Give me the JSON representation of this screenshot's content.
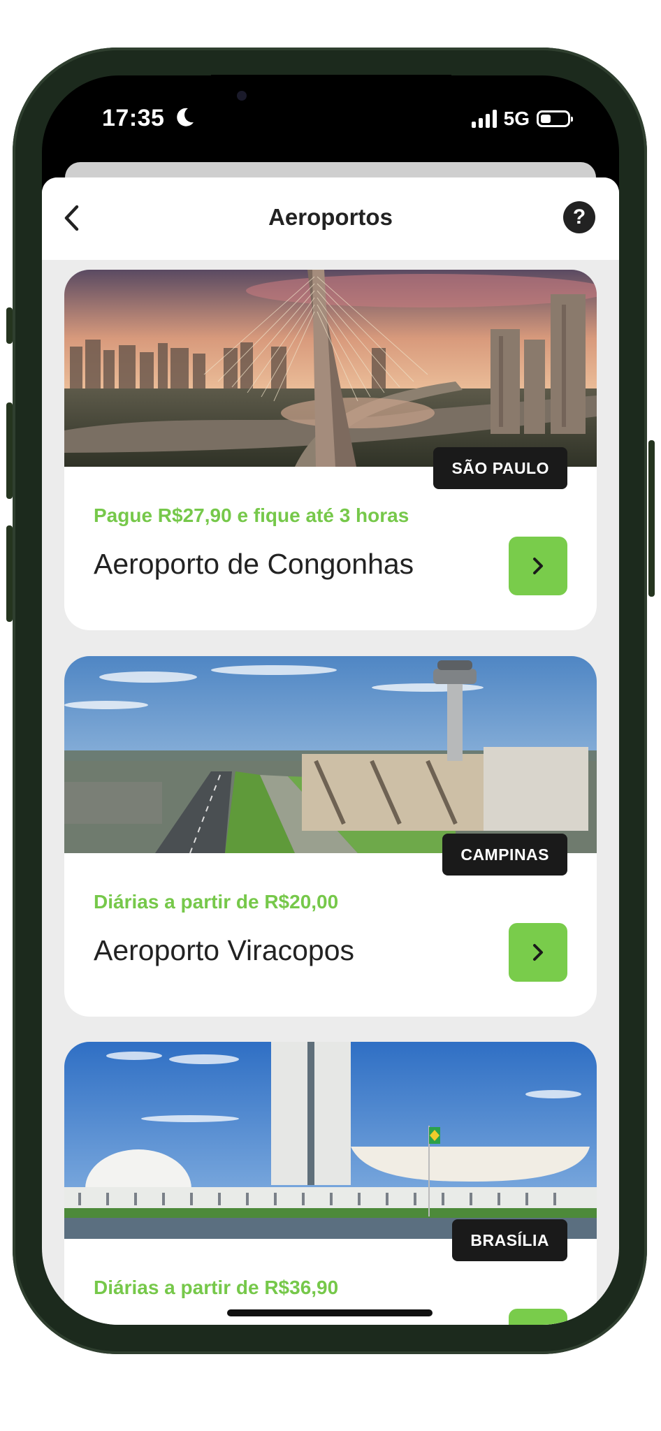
{
  "status_bar": {
    "time": "17:35",
    "network": "5G"
  },
  "header": {
    "title": "Aeroportos",
    "help_label": "?"
  },
  "airports": [
    {
      "city": "SÃO PAULO",
      "promo": "Pague R$27,90 e fique até 3 horas",
      "name": "Aeroporto de Congonhas",
      "image": "sao-paulo-bridge-skyline"
    },
    {
      "city": "CAMPINAS",
      "promo": "Diárias a partir de R$20,00",
      "name": "Aeroporto Viracopos",
      "image": "viracopos-control-tower"
    },
    {
      "city": "BRASÍLIA",
      "promo": "Diárias a partir de R$36,90",
      "name": "",
      "image": "brasilia-congress"
    }
  ],
  "colors": {
    "accent": "#79cc4b",
    "promo_text": "#76c84a",
    "badge_bg": "#1a1a1a",
    "sheet_bg": "#ececec"
  },
  "icons": {
    "back": "chevron-left-icon",
    "help": "question-icon",
    "go": "chevron-right-icon",
    "moon": "moon-icon"
  }
}
